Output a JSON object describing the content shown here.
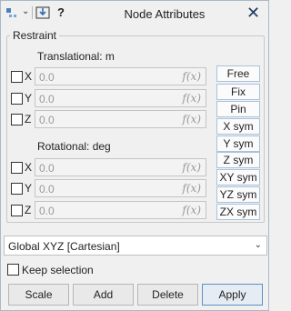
{
  "window": {
    "title": "Node Attributes",
    "help_label": "?",
    "close_label": "✕"
  },
  "restraint": {
    "group_label": "Restraint",
    "translational_label": "Translational: m",
    "rotational_label": "Rotational: deg",
    "translational_rows": [
      {
        "axis": "X",
        "value": "0.0",
        "fx": "f(x)",
        "checked": false
      },
      {
        "axis": "Y",
        "value": "0.0",
        "fx": "f(x)",
        "checked": false
      },
      {
        "axis": "Z",
        "value": "0.0",
        "fx": "f(x)",
        "checked": false
      }
    ],
    "rotational_rows": [
      {
        "axis": "X",
        "value": "0.0",
        "fx": "f(x)",
        "checked": false
      },
      {
        "axis": "Y",
        "value": "0.0",
        "fx": "f(x)",
        "checked": false
      },
      {
        "axis": "Z",
        "value": "0.0",
        "fx": "f(x)",
        "checked": false
      }
    ],
    "quick_buttons": [
      "Free",
      "Fix",
      "Pin",
      "X sym",
      "Y sym",
      "Z sym",
      "XY sym",
      "YZ sym",
      "ZX sym"
    ]
  },
  "coordinate_system": {
    "selected": "Global XYZ [Cartesian]"
  },
  "keep_selection": {
    "label": "Keep selection",
    "checked": false
  },
  "buttons": {
    "scale_label": "Scale",
    "add_label": "Add",
    "delete_label": "Delete",
    "apply_label": "Apply"
  },
  "colors": {
    "accent": "#5b8fc9",
    "close_icon": "#1e3a5f",
    "button_border": "#a8c2dc"
  }
}
